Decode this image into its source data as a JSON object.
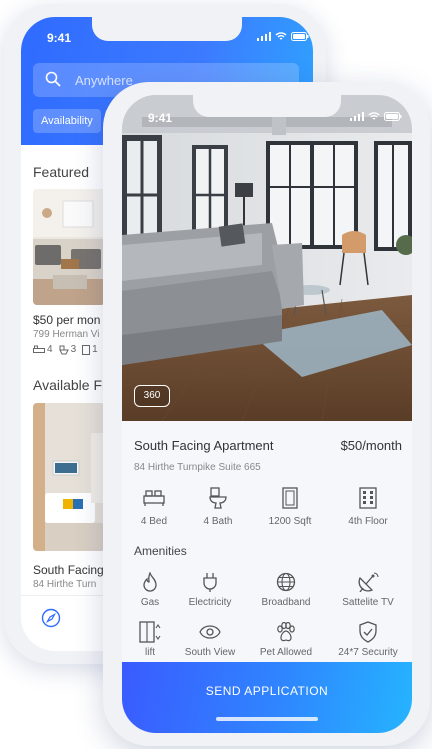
{
  "back_screen": {
    "status_time": "9:41",
    "search_placeholder": "Anywhere",
    "chips": [
      "Availability"
    ],
    "featured_title": "Featured",
    "featured_card": {
      "price": "$50 per mon",
      "address": "799 Herman Vi",
      "beds": "4",
      "baths": "3",
      "extra": "1"
    },
    "available_title": "Available Fr",
    "available_card": {
      "title": "South Facing",
      "address": "84 Hirthe Turn"
    }
  },
  "front_screen": {
    "status_time": "9:41",
    "badge": "360",
    "listing": {
      "title": "South Facing Apartment",
      "price": "$50/month",
      "address": "84 Hirthe Turnpike Suite 665"
    },
    "features": [
      {
        "icon": "bed-icon",
        "label": "4 Bed"
      },
      {
        "icon": "toilet-icon",
        "label": "4 Bath"
      },
      {
        "icon": "area-icon",
        "label": "1200 Sqft"
      },
      {
        "icon": "building-icon",
        "label": "4th Floor"
      }
    ],
    "amenities_title": "Amenities",
    "amenities": [
      {
        "icon": "flame-icon",
        "label": "Gas"
      },
      {
        "icon": "plug-icon",
        "label": "Electricity"
      },
      {
        "icon": "globe-icon",
        "label": "Broadband"
      },
      {
        "icon": "satellite-icon",
        "label": "Sattelite TV"
      },
      {
        "icon": "elevator-icon",
        "label": "lift"
      },
      {
        "icon": "eye-icon",
        "label": "South View"
      },
      {
        "icon": "paw-icon",
        "label": "Pet Allowed"
      },
      {
        "icon": "shield-icon",
        "label": "24*7 Security"
      }
    ],
    "cta": "SEND APPLICATION"
  },
  "colors": {
    "accent_start": "#2f6bff",
    "accent_end": "#25b4ff",
    "text": "#333333",
    "muted": "#888888"
  }
}
